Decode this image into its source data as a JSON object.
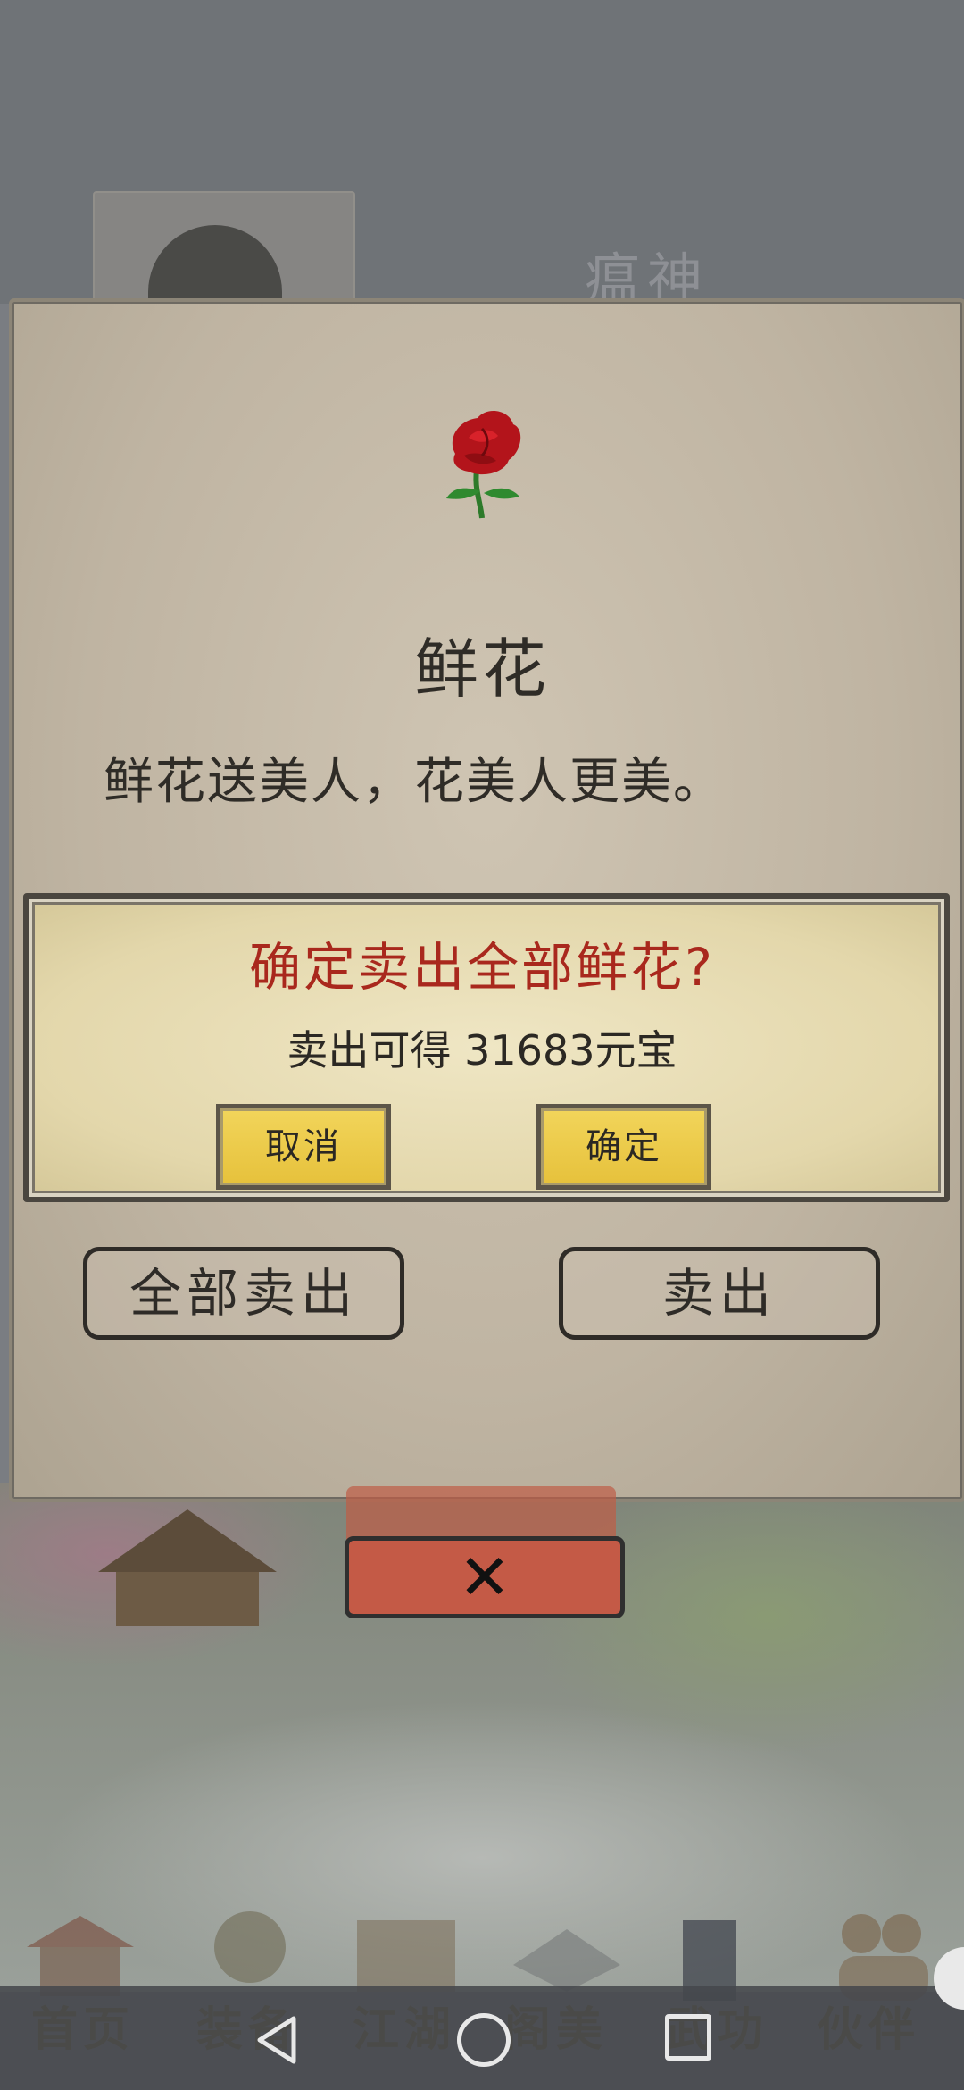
{
  "background": {
    "character_name": "瘟神",
    "bottom_nav": [
      {
        "label": "首页",
        "icon": "palace-icon"
      },
      {
        "label": "装备",
        "icon": "armor-icon"
      },
      {
        "label": "江湖",
        "icon": "scroll-icon"
      },
      {
        "label": "阁美",
        "icon": "book-icon"
      },
      {
        "label": "武功",
        "icon": "sword-icon"
      },
      {
        "label": "伙伴",
        "icon": "partners-icon"
      }
    ]
  },
  "item_dialog": {
    "icon": "rose-icon",
    "name": "鲜花",
    "description": "鲜花送美人，花美人更美。",
    "sell_all_label": "全部卖出",
    "sell_label": "卖出",
    "close_icon": "close-x-icon"
  },
  "confirm_dialog": {
    "title": "确定卖出全部鲜花?",
    "subtitle": "卖出可得 31683元宝",
    "cancel_label": "取消",
    "confirm_label": "确定"
  },
  "system_nav": {
    "back_icon": "back-triangle-icon",
    "home_icon": "home-circle-icon",
    "recents_icon": "recents-square-icon"
  },
  "colors": {
    "confirm_title": "#a9281d",
    "yellow_button": "#f2d55b",
    "close_button": "#c45a46"
  }
}
